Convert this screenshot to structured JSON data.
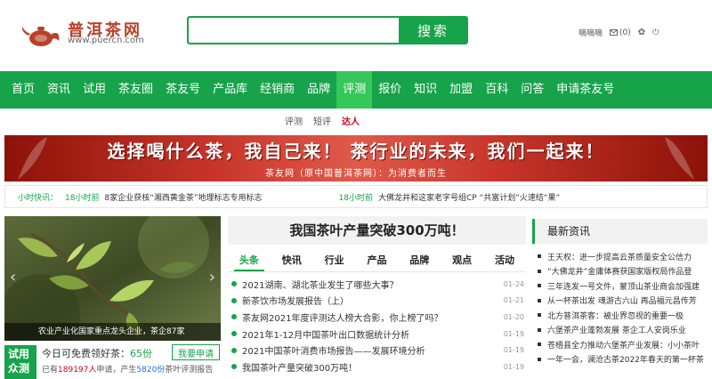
{
  "header": {
    "logo_name": "普洱茶网",
    "logo_url": "www.puercn.com",
    "search_placeholder": "",
    "search_label": "搜索",
    "user_name": "嘀嘀嘀",
    "mail_count": "(0)",
    "colors": {
      "brand": "#16a34a",
      "logo": "#b8412a"
    }
  },
  "nav": {
    "items": [
      "首页",
      "资讯",
      "试用",
      "茶友圈",
      "茶友号",
      "产品库",
      "经销商",
      "品牌",
      "评测",
      "报价",
      "知识",
      "加盟",
      "百科",
      "问答",
      "申请茶友号"
    ],
    "active": "评测"
  },
  "subnav": {
    "items": [
      "评测",
      "短评",
      "达人"
    ],
    "active": "达人"
  },
  "banner": {
    "title": "选择喝什么茶，我自己来！  茶行业的未来，我们一起来！",
    "subtitle": "茶友网（原中国普洱茶网）：为消费者而生"
  },
  "flash": {
    "label": "小时快讯：",
    "items": [
      {
        "time": "18小时前",
        "text": "8家企业获核“湘西黄金茶”地理标志专用标志"
      },
      {
        "time": "18小时前",
        "text": "大佛龙井和这家老字号组CP  “共富计划”火速结“果”"
      }
    ]
  },
  "photo": {
    "caption": "农业产业化国家重点龙头企业，茶企87家"
  },
  "trial": {
    "badge_top": "试用",
    "badge_bottom": "众测",
    "title_prefix": "今日可免费领好茶：",
    "title_count": "65份",
    "button": "我要申请",
    "stats_p1": "已有",
    "applicants": "189197人",
    "stats_p2": "申请，产生",
    "reports": "5820份",
    "stats_p3": "茶叶评测报告"
  },
  "main": {
    "headline": "我国茶叶产量突破300万吨！",
    "tabs": [
      "头条",
      "快讯",
      "行业",
      "产品",
      "品牌",
      "观点",
      "活动"
    ],
    "active_tab": "头条",
    "news": [
      {
        "title": "2021湖南、湖北茶业发生了哪些大事？",
        "date": "01-24"
      },
      {
        "title": "新茶饮市场发展报告（上）",
        "date": "01-21"
      },
      {
        "title": "茶友网2021年度评测达人榜大合影，你上榜了吗？",
        "date": "01-20"
      },
      {
        "title": "2021年1-12月中国茶叶出口数据统计分析",
        "date": "01-19"
      },
      {
        "title": "2021中国茶叶消费市场报告——发展环境分析",
        "date": "01-19"
      },
      {
        "title": "我国茶叶产量突破300万吨！",
        "date": "01-19"
      }
    ]
  },
  "latest": {
    "title": "最新资讯",
    "items": [
      "王天权：进一步提高云茶质量安全公信力",
      "“大佛龙井”金庸体赛获国家版权局作品登",
      "三年连发一号文件，蒙顶山茶业商会加强建",
      "从一杯茶出发 魂游古六山 再品福元昌传芳",
      "北方普洱茶客：被业界忽视的重要一极",
      "六堡茶产业蓬勃发展 茶企工人安岗乐业",
      "苍梧县全力推动六堡茶产业发展：小小茶叶",
      "一年一会，澜沧古茶2022年春天的第一杯茶"
    ]
  }
}
